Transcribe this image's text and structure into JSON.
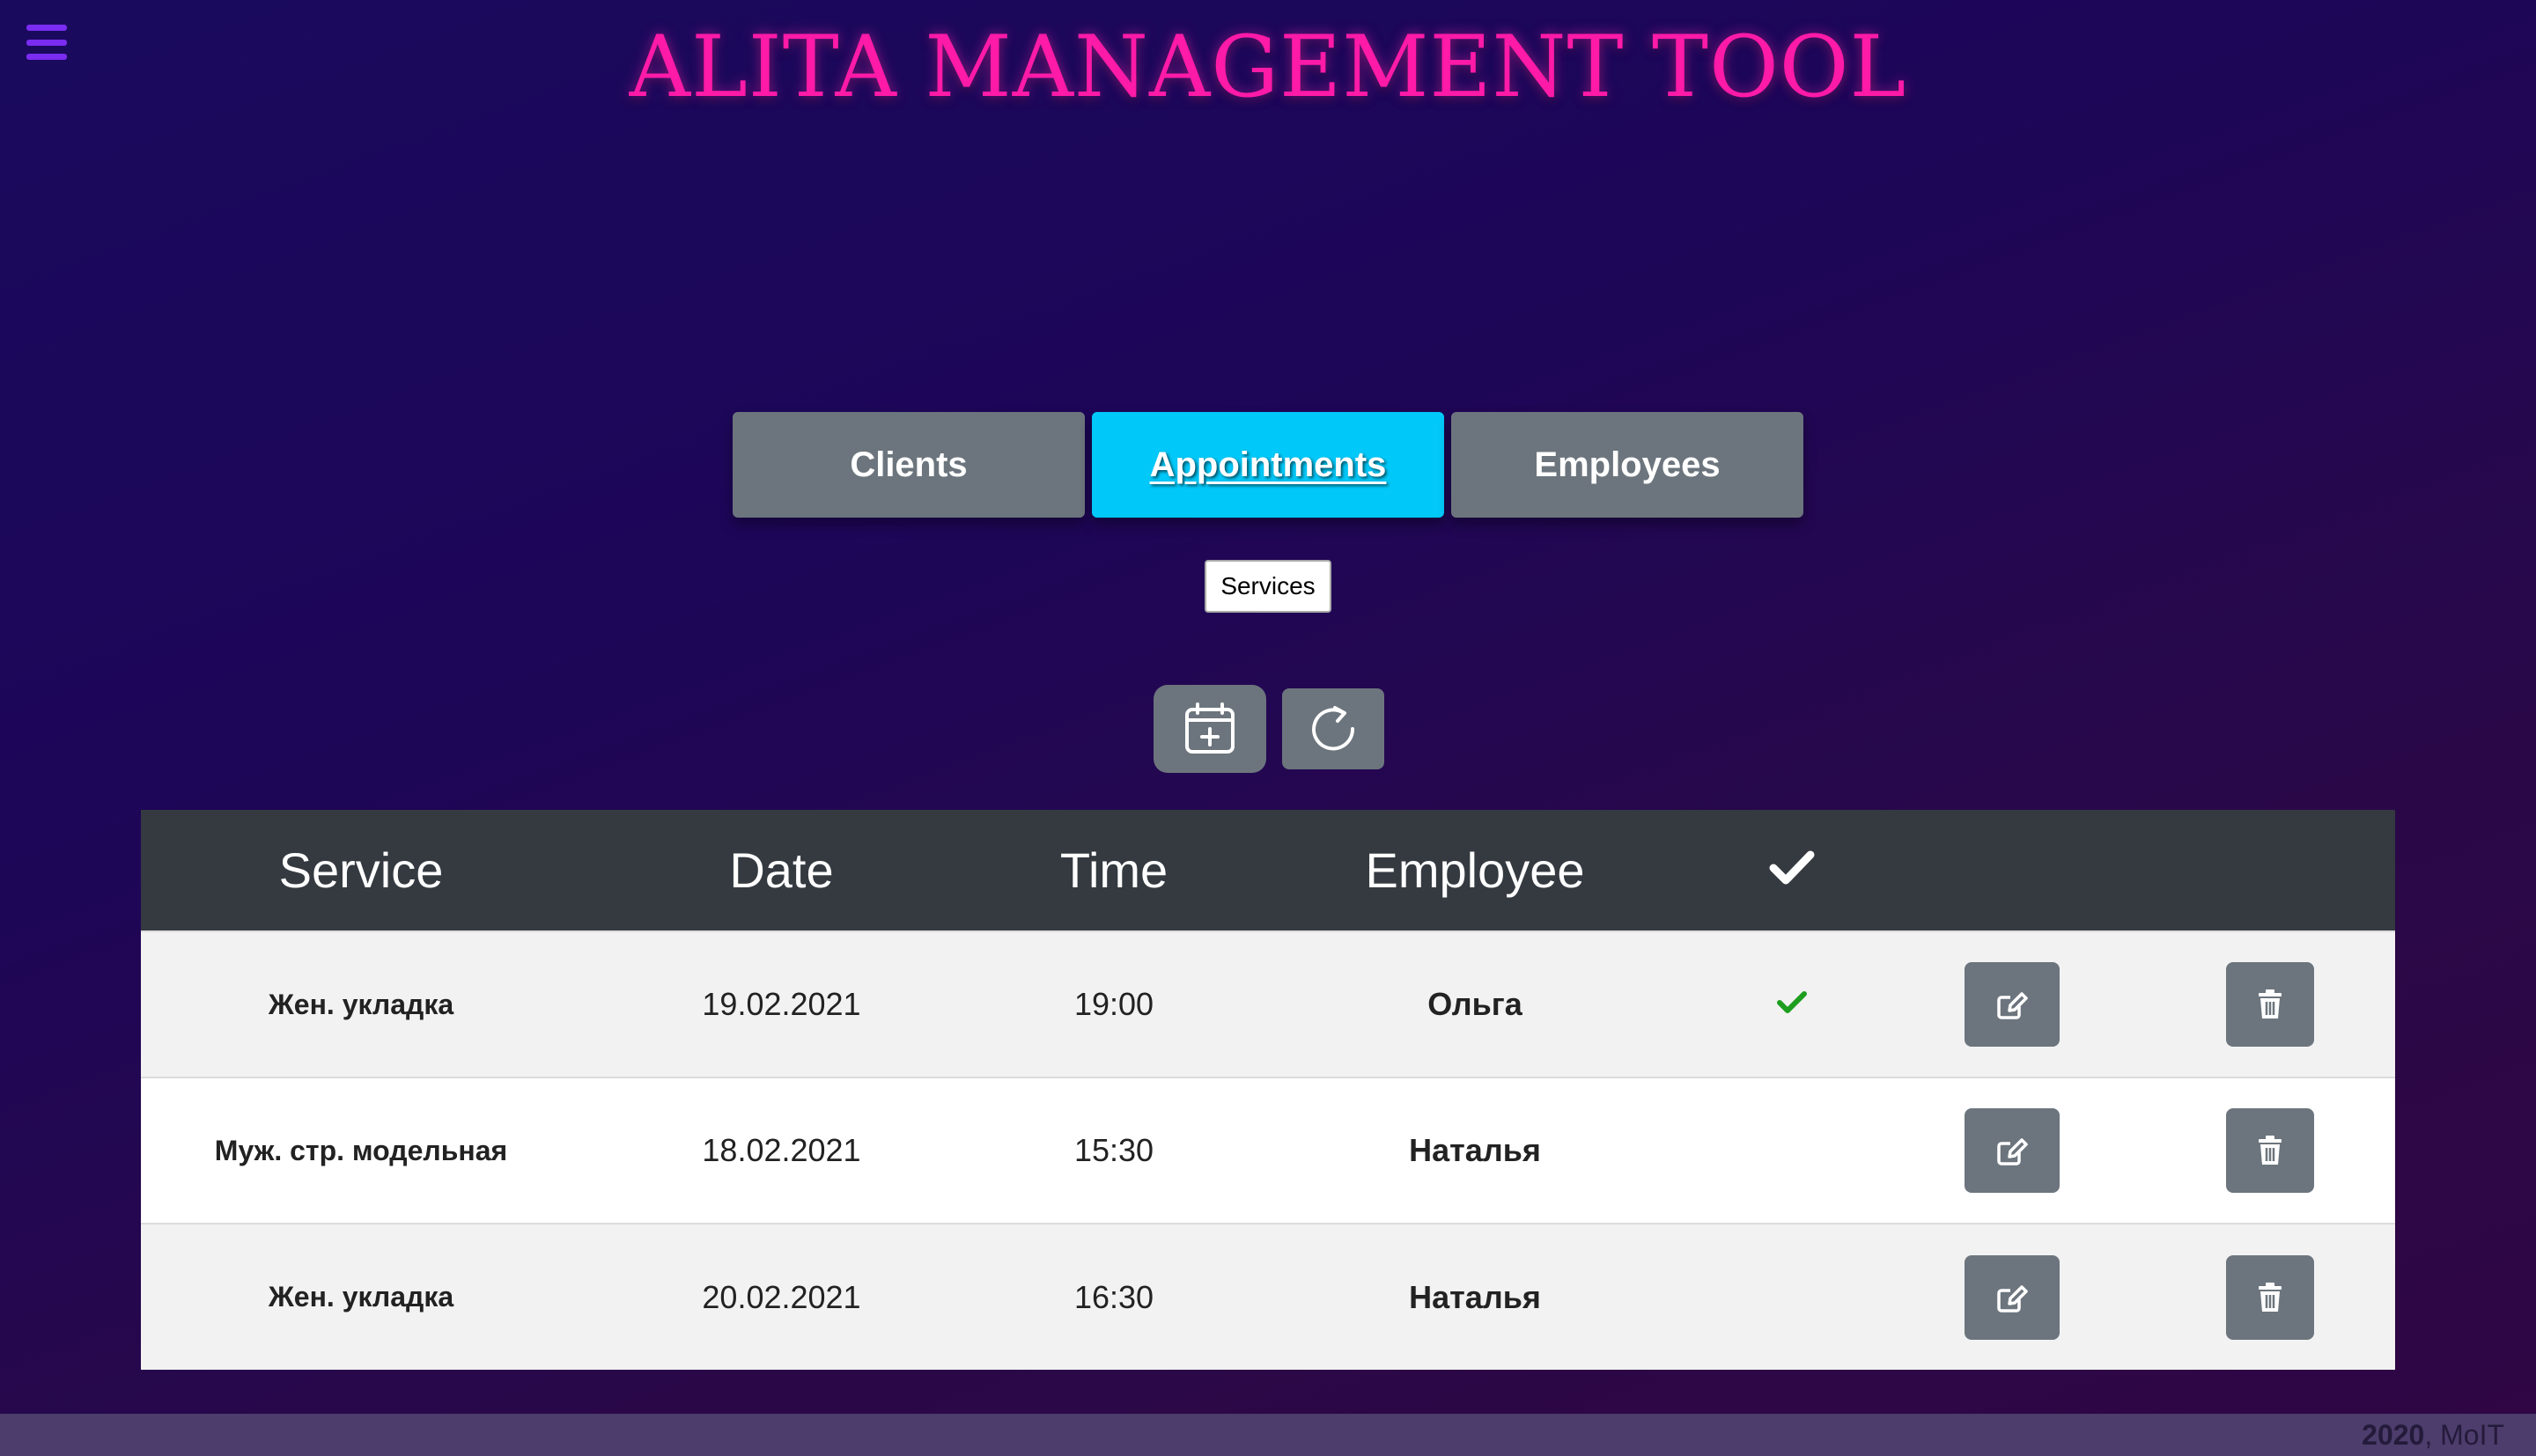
{
  "header": {
    "title": "ALITA MANAGEMENT TOOL",
    "menu_icon": "hamburger-icon"
  },
  "tabs": [
    {
      "label": "Clients",
      "active": false
    },
    {
      "label": "Appointments",
      "active": true
    },
    {
      "label": "Employees",
      "active": false
    }
  ],
  "tooltip": {
    "text": "Services"
  },
  "actions": {
    "add_icon": "calendar-plus-icon",
    "refresh_icon": "refresh-icon"
  },
  "table": {
    "headers": {
      "service": "Service",
      "date": "Date",
      "time": "Time",
      "employee": "Employee",
      "done_icon": "checkmark-icon"
    },
    "rows": [
      {
        "service": "Жен. укладка",
        "date": "19.02.2021",
        "time": "19:00",
        "employee": "Ольга",
        "done": true
      },
      {
        "service": "Муж. стр. модельная",
        "date": "18.02.2021",
        "time": "15:30",
        "employee": "Наталья",
        "done": false
      },
      {
        "service": "Жен. укладка",
        "date": "20.02.2021",
        "time": "16:30",
        "employee": "Наталья",
        "done": false
      }
    ],
    "row_icons": {
      "edit": "edit-icon",
      "delete": "trash-icon"
    }
  },
  "footer": {
    "year": "2020",
    "author": ", MoIT"
  },
  "colors": {
    "title": "#ff1aa8",
    "active_tab": "#00c8f8",
    "button_gray": "#6c757d",
    "table_header": "#343a40",
    "check_green": "#1e9e1e",
    "menu_icon": "#7a2cf0"
  }
}
